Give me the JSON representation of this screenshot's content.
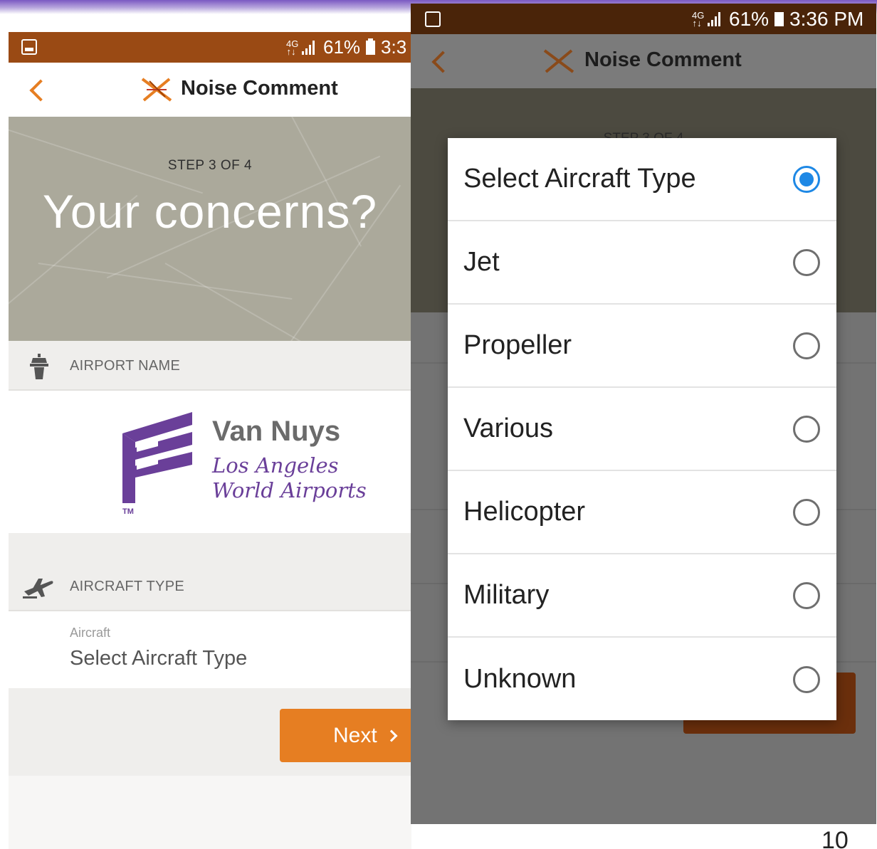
{
  "left": {
    "status": {
      "battery": "61%",
      "time": "3:3"
    },
    "header": {
      "title": "Noise Comment"
    },
    "hero": {
      "step": "STEP 3 OF 4",
      "headline": "Your concerns?"
    },
    "airport_section": {
      "label": "AIRPORT NAME"
    },
    "airport_logo": {
      "name": "Van Nuys",
      "line1": "Los Angeles",
      "line2": "World Airports",
      "tm": "TM"
    },
    "aircraft_section": {
      "label": "AIRCRAFT TYPE"
    },
    "aircraft_field": {
      "label": "Aircraft",
      "value": "Select Aircraft Type"
    },
    "next_label": "Next"
  },
  "right": {
    "status": {
      "battery": "61%",
      "time": "3:36 PM"
    },
    "header": {
      "title": "Noise Comment"
    },
    "hero": {
      "step_partial": "STEP 3 OF 4"
    },
    "dialog": {
      "options": [
        {
          "label": "Select Aircraft Type",
          "selected": true
        },
        {
          "label": "Jet",
          "selected": false
        },
        {
          "label": "Propeller",
          "selected": false
        },
        {
          "label": "Various",
          "selected": false
        },
        {
          "label": "Helicopter",
          "selected": false
        },
        {
          "label": "Military",
          "selected": false
        },
        {
          "label": "Unknown",
          "selected": false
        }
      ]
    }
  },
  "page_number": "10",
  "colors": {
    "accent": "#e67e22",
    "status_bar": "#9a4a14",
    "brand_purple": "#6a3f99",
    "radio_selected": "#1e88e5"
  },
  "icons": [
    "gallery-icon",
    "network-icon",
    "signal-icon",
    "battery-icon",
    "back-chevron-icon",
    "noise-logo-icon",
    "tower-icon",
    "airplane-icon",
    "chevron-right-icon"
  ]
}
